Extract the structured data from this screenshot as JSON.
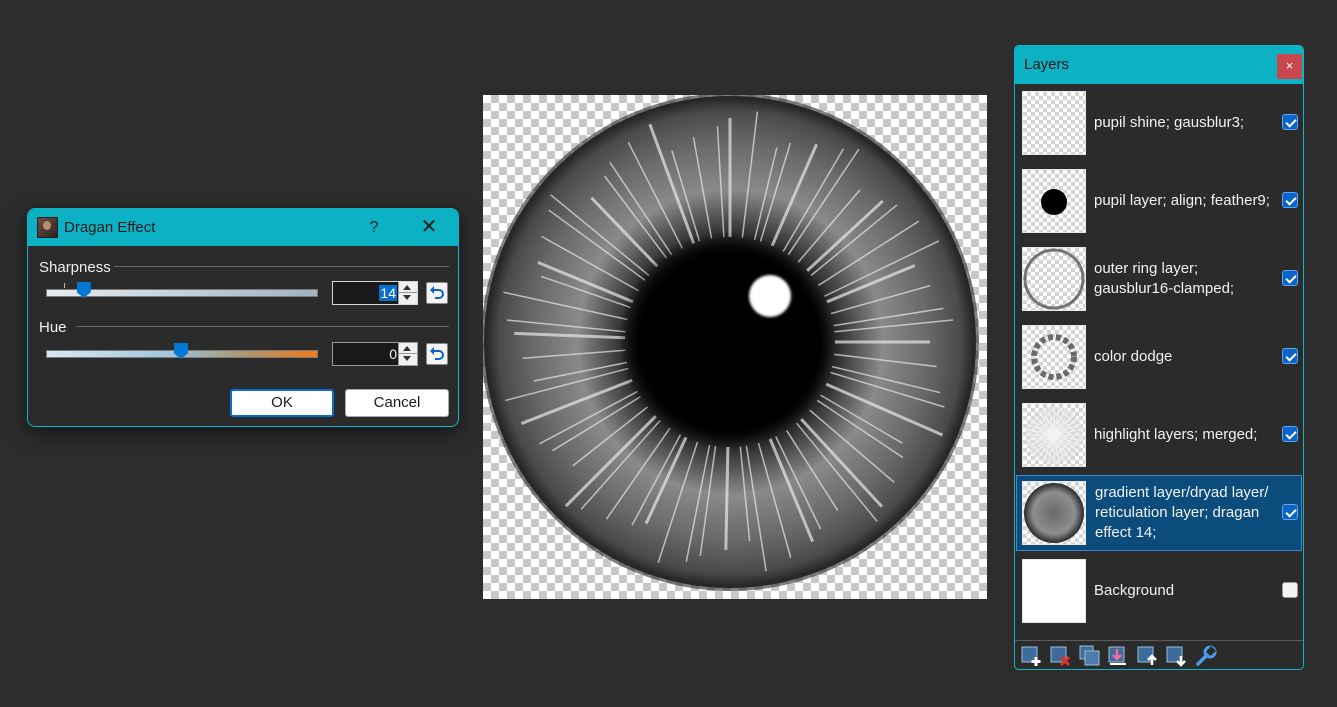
{
  "dialog": {
    "title": "Dragan Effect",
    "help_glyph": "?",
    "close_glyph": "✕",
    "sharpness": {
      "label": "Sharpness",
      "value": "14",
      "slider_fraction": 0.14
    },
    "hue": {
      "label": "Hue",
      "value": "0",
      "slider_fraction": 0.5
    },
    "ok_label": "OK",
    "cancel_label": "Cancel"
  },
  "layers_panel": {
    "title": "Layers",
    "close_glyph": "×",
    "layers": [
      {
        "name": "pupil shine; gausblur3;",
        "visible": true,
        "thumb": "pupil-shine"
      },
      {
        "name": "pupil layer; align; feather9;",
        "visible": true,
        "thumb": "pupil"
      },
      {
        "name": "outer ring layer; gausblur16-clamped;",
        "visible": true,
        "thumb": "outer-ring"
      },
      {
        "name": "color dodge",
        "visible": true,
        "thumb": "color-dodge"
      },
      {
        "name": "highlight layers; merged;",
        "visible": true,
        "thumb": "highlight"
      },
      {
        "name": "gradient layer/dryad layer/ reticulation layer; dragan effect 14;",
        "visible": true,
        "thumb": "gradient",
        "selected": true
      },
      {
        "name": "Background",
        "visible": false,
        "thumb": "background"
      }
    ],
    "toolbar": [
      "add-layer-icon",
      "delete-layer-icon",
      "duplicate-layer-icon",
      "merge-down-icon",
      "move-layer-up-icon",
      "move-layer-down-icon",
      "layer-properties-icon"
    ]
  },
  "colors": {
    "accent": "#0cb1c3",
    "background": "#2d2d2d",
    "selection": "#0c4c7c",
    "checkbox_on": "#0a64c8",
    "close_red": "#c8474f",
    "slider_thumb": "#0078d4"
  }
}
